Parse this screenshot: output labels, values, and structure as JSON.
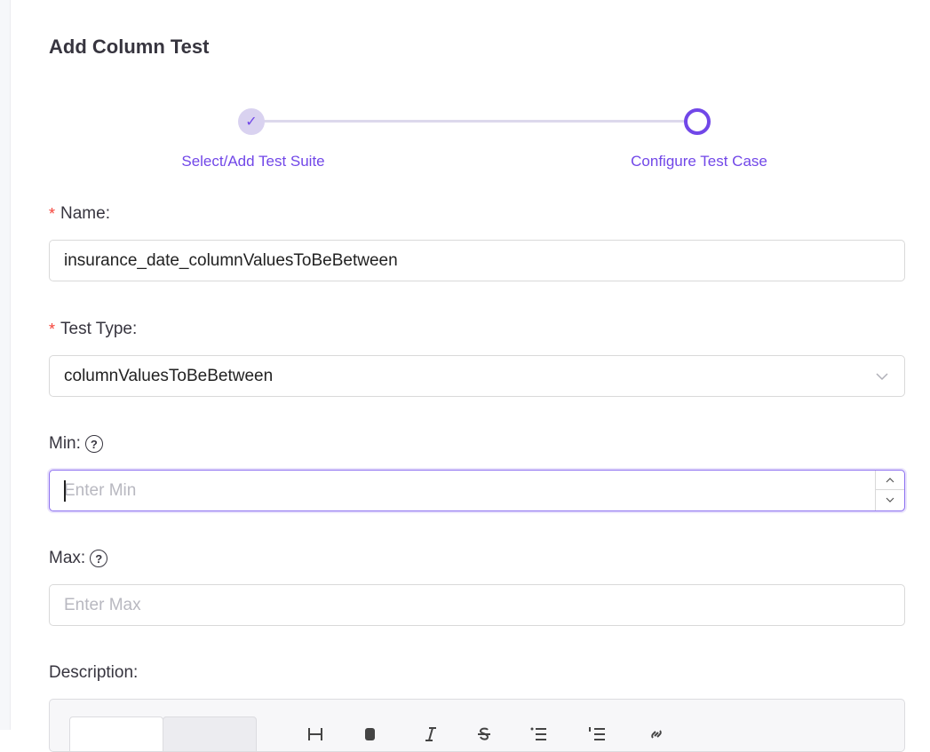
{
  "page": {
    "title": "Add Column Test"
  },
  "stepper": {
    "steps": [
      {
        "label": "Select/Add Test Suite",
        "status": "done"
      },
      {
        "label": "Configure Test Case",
        "status": "active"
      }
    ],
    "check_glyph": "✓"
  },
  "form": {
    "name": {
      "label": "Name:",
      "required_mark": "*",
      "value": "insurance_date_columnValuesToBeBetween"
    },
    "test_type": {
      "label": "Test Type:",
      "required_mark": "*",
      "value": "columnValuesToBeBetween"
    },
    "min": {
      "label": "Min:",
      "placeholder": "Enter Min",
      "help_glyph": "?"
    },
    "max": {
      "label": "Max:",
      "placeholder": "Enter Max",
      "help_glyph": "?"
    },
    "description": {
      "label": "Description:"
    }
  },
  "colors": {
    "accent": "#7147e8",
    "required": "#f5433a",
    "step_done_bg": "#d9d2f0"
  }
}
